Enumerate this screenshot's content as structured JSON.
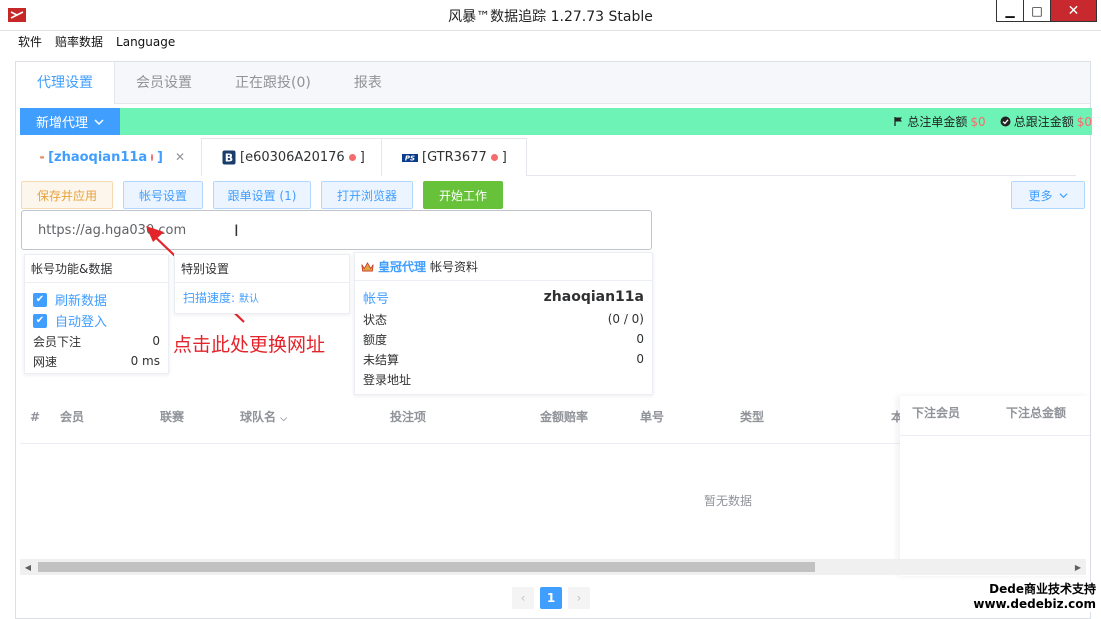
{
  "window": {
    "title": "风暴™数据追踪 1.27.73 Stable",
    "minimize": "▁",
    "maximize": "□",
    "close": "✕"
  },
  "menu": [
    "软件",
    "赔率数据",
    "Language"
  ],
  "top_tabs": [
    "代理设置",
    "会员设置",
    "正在跟投(0)",
    "报表"
  ],
  "toolbar": {
    "add_proxy": "新增代理",
    "total_bet_label": "总注单金额",
    "total_bet_value": "$0",
    "total_follow_label": "总跟注金额",
    "total_follow_value": "$0"
  },
  "account_tabs": [
    {
      "label": "[zhaoqian11a",
      "suffix": "]"
    },
    {
      "label": "[e60306A20176",
      "suffix": "]"
    },
    {
      "label": "[GTR3677",
      "suffix": "]"
    }
  ],
  "actions": {
    "save_apply": "保存并应用",
    "account_settings": "帐号设置",
    "follow_settings": "跟单设置 (1)",
    "open_browser": "打开浏览器",
    "start_work": "开始工作",
    "more": "更多"
  },
  "url": {
    "value": "https://ag.hga030.com"
  },
  "card_account": {
    "title": "帐号功能&数据",
    "refresh": "刷新数据",
    "autologin": "自动登入",
    "member_bet_label": "会员下注",
    "member_bet_value": "0",
    "speed_label": "网速",
    "speed_value": "0 ms"
  },
  "card_special": {
    "title": "特别设置",
    "scan_label": "扫描速度:",
    "scan_value": "默认"
  },
  "card_profile": {
    "brand": "皇冠代理",
    "title": "帐号资料",
    "account_label": "帐号",
    "account_value": "zhaoqian11a",
    "status_label": "状态",
    "status_value": "(0 / 0)",
    "quota_label": "额度",
    "quota_value": "0",
    "unsettled_label": "未结算",
    "unsettled_value": "0",
    "login_label": "登录地址"
  },
  "annotation": "点击此处更换网址",
  "table": {
    "columns": [
      "#",
      "会员",
      "联赛",
      "球队名",
      "投注项",
      "金额赔率",
      "单号",
      "类型",
      "本",
      "下注会员",
      "下注总金额"
    ],
    "empty": "暂无数据"
  },
  "pagination": {
    "current": "1",
    "prev": "‹",
    "next": "›"
  },
  "watermark": {
    "line1": "Dede商业技术支持",
    "line2": "www.dedebiz.com"
  }
}
